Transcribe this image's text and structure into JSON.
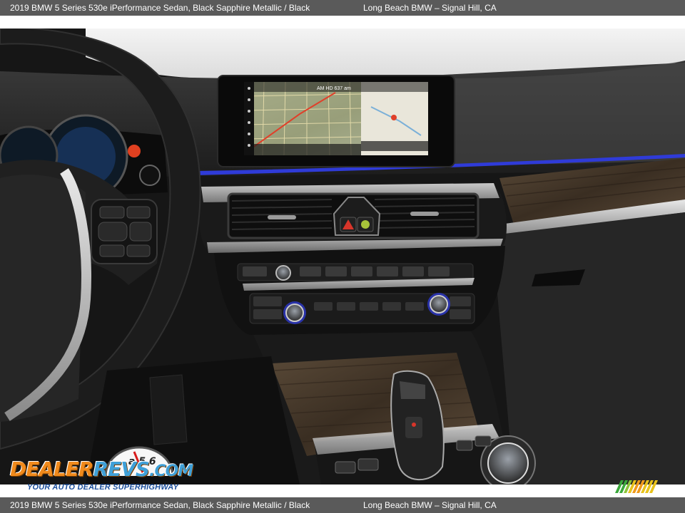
{
  "caption": {
    "vehicle": "2019 BMW 5 Series 530e iPerformance Sedan,  Black Sapphire Metallic / Black",
    "dealer": "Long Beach BMW – Signal Hill, CA"
  },
  "watermark": {
    "brand_left": "DEALER",
    "brand_mid": "REVS",
    "brand_right": ".COM",
    "tagline": "YOUR AUTO DEALER SUPERHIGHWAY",
    "gauge_digits": "a 5 6"
  },
  "nav_screen": {
    "status": "AM HD  637 am"
  },
  "icons": {
    "hazard": "hazard-icon",
    "nav": "map-icon"
  },
  "colors": {
    "accent_light": "#2f3bd8",
    "caption_bg": "#5a5a5a",
    "wood": "#4a3a2a"
  }
}
